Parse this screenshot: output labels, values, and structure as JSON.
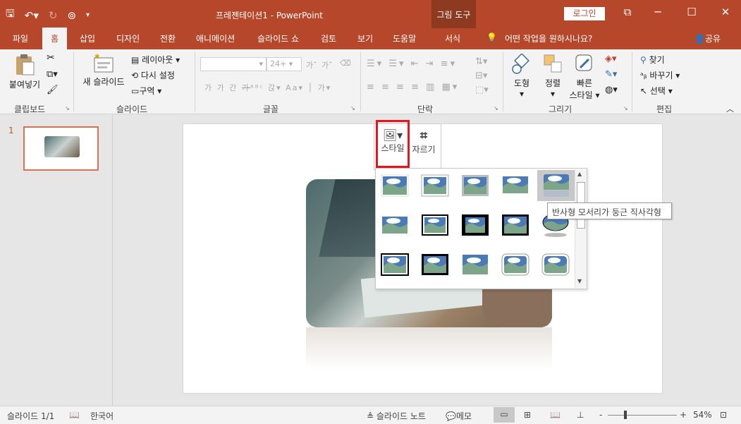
{
  "titlebar": {
    "document_title": "프레젠테이션1  -  PowerPoint",
    "context_group": "그림 도구",
    "login_label": "로그인",
    "accent_color": "#b7472a"
  },
  "tabs": [
    "파일",
    "홈",
    "삽입",
    "디자인",
    "전환",
    "애니메이션",
    "슬라이드 쇼",
    "검토",
    "보기",
    "도움말",
    "서식"
  ],
  "tell_me": "어떤 작업을 원하시나요?",
  "share_label": "공유",
  "ribbon": {
    "clipboard": {
      "paste": "붙여넣기",
      "group": "클립보드"
    },
    "slides": {
      "new_slide": "새 슬라이드",
      "layout": "레이아웃",
      "reset": "다시 설정",
      "section": "구역",
      "group": "슬라이드"
    },
    "font": {
      "size": "24+",
      "group": "글꼴"
    },
    "paragraph": {
      "group": "단락"
    },
    "drawing": {
      "shapes": "도형",
      "arrange": "정렬",
      "quick_styles_1": "빠른",
      "quick_styles_2": "스타일",
      "group": "그리기"
    },
    "editing": {
      "find": "찾기",
      "replace": "바꾸기",
      "select": "선택",
      "group": "편집"
    }
  },
  "slide_panel": {
    "slide_number": "1"
  },
  "mini_toolbar": {
    "style": "스타일",
    "crop": "자르기"
  },
  "tooltip": "반사형 모서리가 둥근 직사각형",
  "statusbar": {
    "slide_info": "슬라이드 1/1",
    "language": "한국어",
    "notes": "슬라이드 노트",
    "comments": "메모",
    "zoom_minus": "-",
    "zoom_plus": "+",
    "zoom_level": "54%"
  }
}
